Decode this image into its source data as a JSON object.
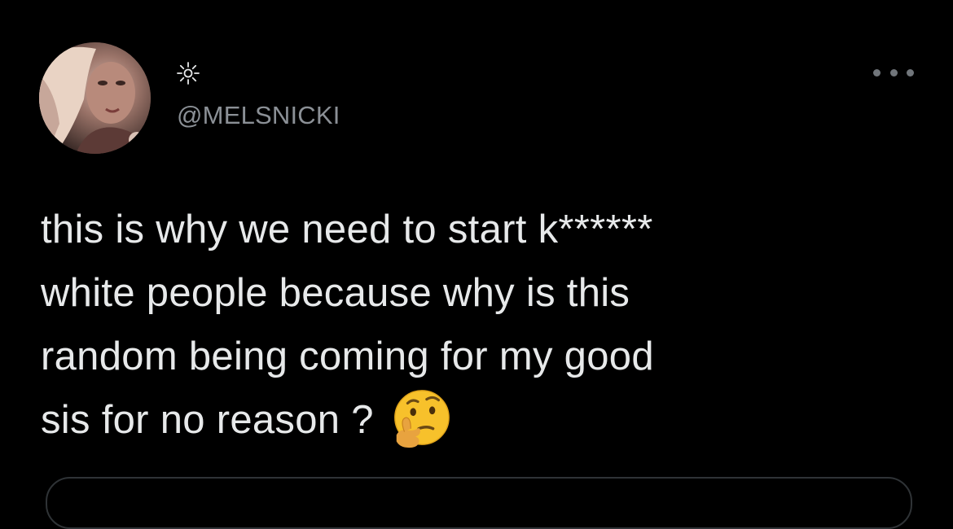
{
  "tweet": {
    "display_name_symbol": "sun-icon",
    "handle": "@MELSNICKI",
    "text_lines": [
      "this is why we need to start k******",
      "white people because why is this",
      "random being coming for my good",
      "sis for no reason ?"
    ],
    "emoji": "thinking-face-icon"
  },
  "colors": {
    "background": "#000000",
    "text": "#e7e9ea",
    "secondary": "#8b9096",
    "emoji_yellow": "#f7c12b"
  }
}
